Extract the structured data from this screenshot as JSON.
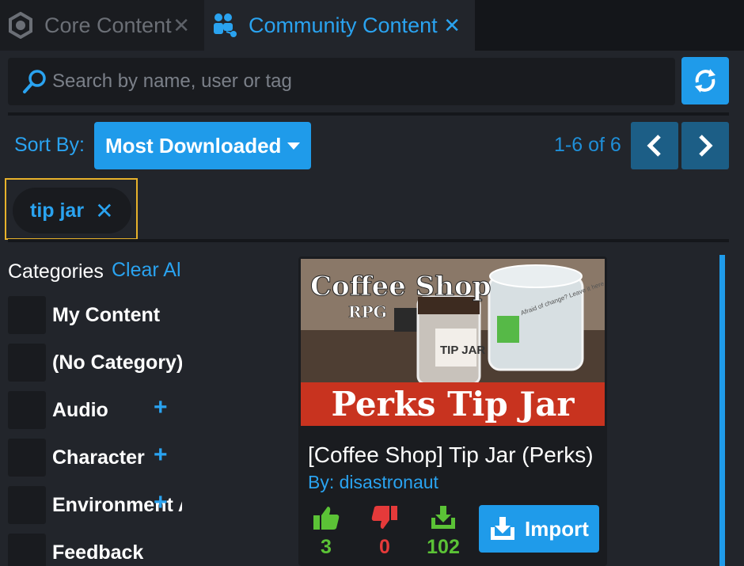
{
  "tabs": [
    {
      "label": "Core Content",
      "close": "✕"
    },
    {
      "label": "Community Content",
      "close": "✕"
    }
  ],
  "search": {
    "placeholder": "Search by name, user or tag"
  },
  "sort": {
    "label": "Sort By:",
    "selected": "Most Downloaded"
  },
  "paging": {
    "range": "1-6 of 6"
  },
  "tag_filter": {
    "tag": "tip jar",
    "remove": "✕"
  },
  "categories": {
    "title": "Categories",
    "clear_label": "Clear All",
    "items": [
      {
        "label": "My Content",
        "plus": ""
      },
      {
        "label": "(No Category)",
        "plus": ""
      },
      {
        "label": "Audio",
        "plus": "+"
      },
      {
        "label": "Character",
        "plus": "+"
      },
      {
        "label": "Environment Art",
        "plus": "+"
      },
      {
        "label": "Feedback",
        "plus": ""
      }
    ]
  },
  "card": {
    "thumbnail": {
      "brand_top": "Coffee Shop",
      "brand_sub": "RPG",
      "jar_label": "TIP JAR",
      "note_text": "Afraid of change? Leave it here",
      "banner": "Perks Tip Jar"
    },
    "title": "[Coffee Shop] Tip Jar (Perks)",
    "author": "By: disastronaut",
    "likes": "3",
    "dislikes": "0",
    "downloads": "102",
    "import_label": "Import"
  },
  "colors": {
    "accent": "#1f9bea",
    "tag_highlight": "#e7b22b",
    "positive": "#5bc236",
    "negative": "#e53a3a"
  }
}
